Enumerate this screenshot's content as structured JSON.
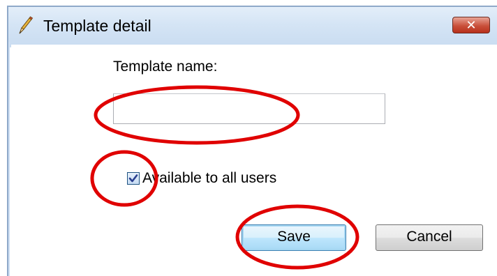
{
  "window": {
    "title": "Template detail",
    "close_label": "✕"
  },
  "form": {
    "name_label": "Template name:",
    "name_value": "",
    "name_placeholder": "",
    "checkbox_label": "Available to all users",
    "checkbox_checked": true
  },
  "buttons": {
    "save_label": "Save",
    "cancel_label": "Cancel"
  },
  "colors": {
    "annotation": "#e00000",
    "titlebar": "#d4e4f5",
    "close_button": "#c9503b"
  }
}
